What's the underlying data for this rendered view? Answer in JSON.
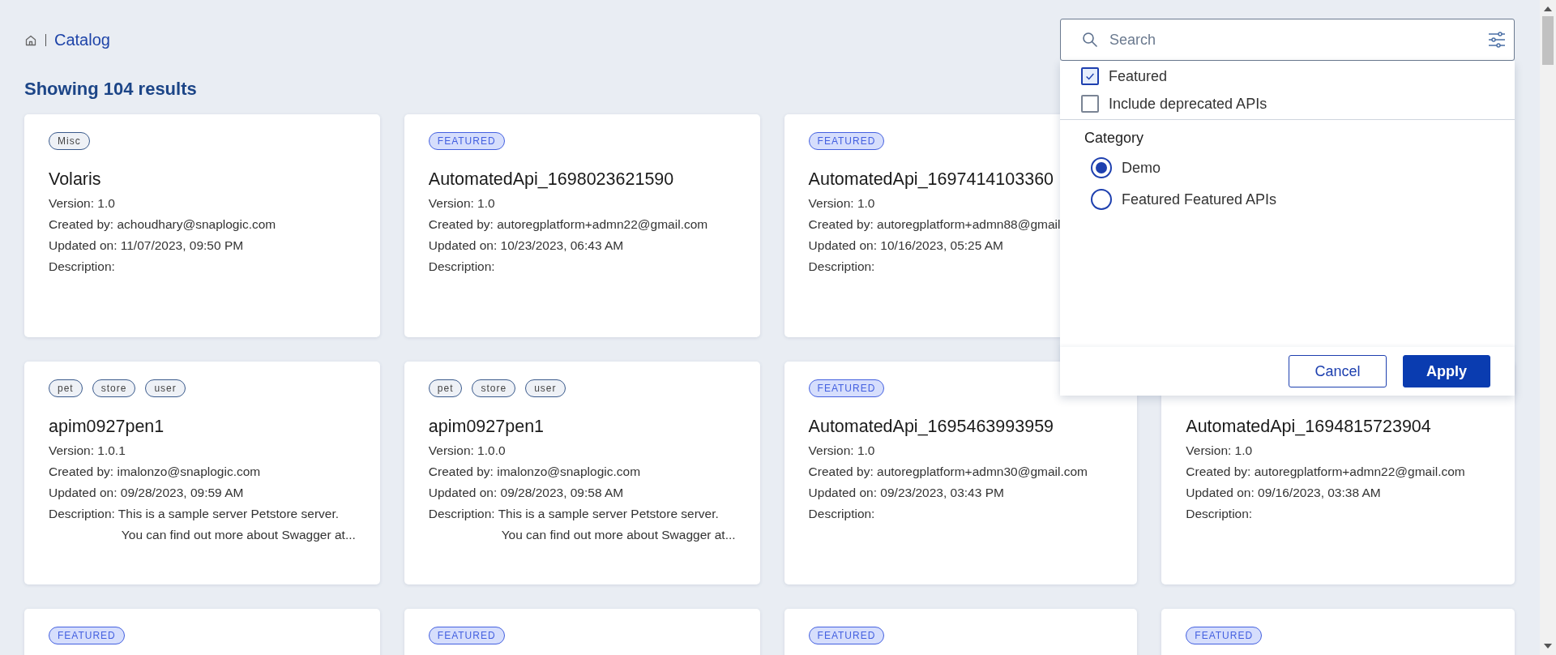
{
  "breadcrumb": {
    "label": "Catalog"
  },
  "results_heading": "Showing 104 results",
  "search": {
    "placeholder": "Search"
  },
  "filter_panel": {
    "options": [
      {
        "label": "Featured",
        "checked": true
      },
      {
        "label": "Include deprecated APIs",
        "checked": false
      }
    ],
    "category_heading": "Category",
    "categories": [
      {
        "label": "Demo",
        "selected": true
      },
      {
        "label": "Featured Featured APIs",
        "selected": false
      }
    ],
    "buttons": [
      {
        "label": "Cancel",
        "kind": "secondary"
      },
      {
        "label": "Apply",
        "kind": "primary"
      }
    ]
  },
  "card_rows": [
    [
      {
        "tags": [
          {
            "label": "Misc",
            "kind": "plain"
          }
        ],
        "title": "Volaris",
        "details": [
          "Version: 1.0",
          "Created by: achoudhary@snaplogic.com",
          "Updated on: 11/07/2023, 09:50 PM"
        ],
        "description": {
          "label": "Description:"
        }
      },
      {
        "tags": [
          {
            "label": "FEATURED",
            "kind": "featured"
          }
        ],
        "title": "AutomatedApi_1698023621590",
        "details": [
          "Version: 1.0",
          "Created by: autoregplatform+admn22@gmail.com",
          "Updated on: 10/23/2023, 06:43 AM"
        ],
        "description": {
          "label": "Description:"
        }
      },
      {
        "tags": [
          {
            "label": "FEATURED",
            "kind": "featured"
          }
        ],
        "title": "AutomatedApi_1697414103360",
        "details": [
          "Version: 1.0",
          "Created by: autoregplatform+admn88@gmail",
          "Updated on: 10/16/2023, 05:25 AM"
        ],
        "description": {
          "label": "Description:"
        }
      }
    ],
    [
      {
        "tags": [
          {
            "label": "pet",
            "kind": "plain"
          },
          {
            "label": "store",
            "kind": "plain"
          },
          {
            "label": "user",
            "kind": "plain"
          }
        ],
        "title": "apim0927pen1",
        "details": [
          "Version: 1.0.1",
          "Created by: imalonzo@snaplogic.com",
          "Updated on: 09/28/2023, 09:59 AM"
        ],
        "description": {
          "label": "Description:",
          "lines": [
            "This is a sample server Petstore server.",
            "You can find out more about Swagger at..."
          ]
        }
      },
      {
        "tags": [
          {
            "label": "pet",
            "kind": "plain"
          },
          {
            "label": "store",
            "kind": "plain"
          },
          {
            "label": "user",
            "kind": "plain"
          }
        ],
        "title": "apim0927pen1",
        "details": [
          "Version: 1.0.0",
          "Created by: imalonzo@snaplogic.com",
          "Updated on: 09/28/2023, 09:58 AM"
        ],
        "description": {
          "label": "Description:",
          "lines": [
            "This is a sample server Petstore server.",
            "You can find out more about Swagger at..."
          ]
        }
      },
      {
        "tags": [
          {
            "label": "FEATURED",
            "kind": "featured"
          }
        ],
        "title": "AutomatedApi_1695463993959",
        "details": [
          "Version: 1.0",
          "Created by: autoregplatform+admn30@gmail.com",
          "Updated on: 09/23/2023, 03:43 PM"
        ],
        "description": {
          "label": "Description:"
        }
      },
      {
        "title": "AutomatedApi_1694815723904",
        "details": [
          "Version: 1.0",
          "Created by: autoregplatform+admn22@gmail.com",
          "Updated on: 09/16/2023, 03:38 AM"
        ],
        "description": {
          "label": "Description:"
        }
      }
    ],
    [
      {
        "tags": [
          {
            "label": "FEATURED",
            "kind": "featured"
          }
        ]
      },
      {
        "tags": [
          {
            "label": "FEATURED",
            "kind": "featured"
          }
        ]
      },
      {
        "tags": [
          {
            "label": "FEATURED",
            "kind": "featured"
          }
        ]
      },
      {
        "tags": [
          {
            "label": "FEATURED",
            "kind": "featured"
          }
        ]
      }
    ]
  ]
}
